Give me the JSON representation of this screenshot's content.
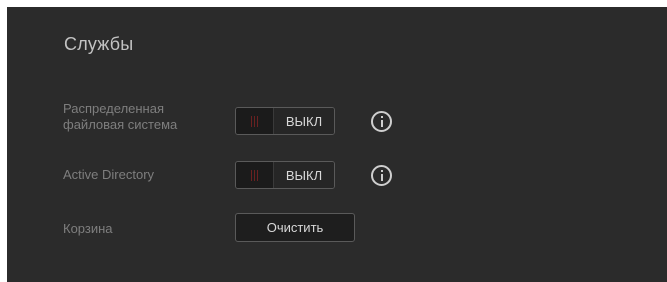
{
  "services": {
    "title": "Службы",
    "rows": [
      {
        "label_line1": "Распределенная",
        "label_line2": "файловая система",
        "toggle_state": "ВЫКЛ"
      },
      {
        "label": "Active Directory",
        "toggle_state": "ВЫКЛ"
      },
      {
        "label": "Корзина",
        "button_label": "Очистить"
      }
    ]
  },
  "icons": {
    "info": "info-icon",
    "toggle_grip": "grip-lines-icon"
  },
  "colors": {
    "panel_background": "#2b2b2b",
    "label_text": "#7e7e7e",
    "title_text": "#c2c2c2",
    "control_text": "#d8d8d8",
    "grip_lines": "#6a2121"
  }
}
